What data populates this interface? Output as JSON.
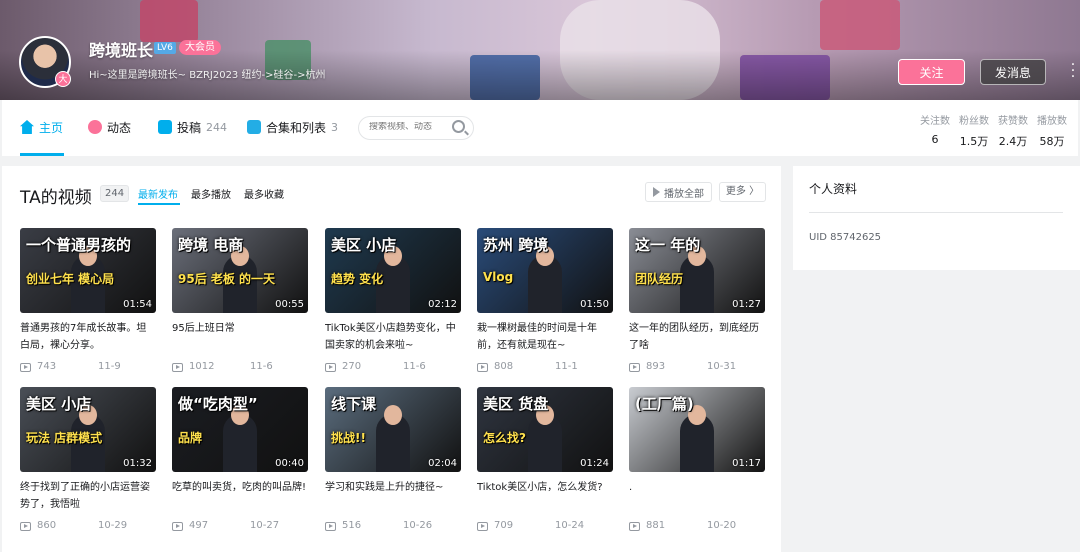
{
  "banner": {
    "username": "跨境班长",
    "level": "LV6",
    "vip_label": "大会员",
    "avatar_badge": "大",
    "signature": "Hi~这里是跨境班长~ BZRJ2023 纽约->硅谷->杭州",
    "follow_label": "关注",
    "message_label": "发消息",
    "more_label": "⋮"
  },
  "nav": {
    "tabs": [
      {
        "label": "主页",
        "count": "",
        "icon": "home-icon",
        "color": "#00aeec"
      },
      {
        "label": "动态",
        "count": "",
        "icon": "dynamic-icon",
        "color": "#fb7299"
      },
      {
        "label": "投稿",
        "count": "244",
        "icon": "upload-icon",
        "color": "#00aeec"
      },
      {
        "label": "合集和列表",
        "count": "3",
        "icon": "collection-icon",
        "color": "#00aeec"
      }
    ],
    "search_placeholder": "搜索视频、动态"
  },
  "stats": [
    {
      "label": "关注数",
      "value": "6"
    },
    {
      "label": "粉丝数",
      "value": "1.5万"
    },
    {
      "label": "获赞数",
      "value": "2.4万"
    },
    {
      "label": "播放数",
      "value": "58万"
    }
  ],
  "videos_section": {
    "title": "TA的视频",
    "count": "244",
    "sort_options": [
      "最新发布",
      "最多播放",
      "最多收藏"
    ],
    "play_all_label": "播放全部",
    "more_label": "更多 〉"
  },
  "videos": [
    {
      "cap1": "一个普通男孩的",
      "cap2": "创业七年 模心局",
      "duration": "01:54",
      "title": "普通男孩的7年成长故事。坦白局，裸心分享。",
      "plays": "743",
      "date": "11-9",
      "bg": "#3a3d45"
    },
    {
      "cap1": "跨境 电商",
      "cap2": "95后 老板 的一天",
      "duration": "00:55",
      "title": "95后上班日常",
      "plays": "1012",
      "date": "11-6",
      "bg": "#6b6f7a"
    },
    {
      "cap1": "美区 小店",
      "cap2": "趋势 变化",
      "duration": "02:12",
      "title": "TikTok美区小店趋势变化，中国卖家的机会来啦~",
      "plays": "270",
      "date": "11-6",
      "bg": "#1f3a4f"
    },
    {
      "cap1": "苏州 跨境",
      "cap2": "Vlog",
      "duration": "01:50",
      "title": "栽一棵树最佳的时间是十年前，还有就是现在~",
      "plays": "808",
      "date": "11-1",
      "bg": "#2a4c7a"
    },
    {
      "cap1": "这一 年的",
      "cap2": "团队经历",
      "duration": "01:27",
      "title": "这一年的团队经历，到底经历了啥",
      "plays": "893",
      "date": "10-31",
      "bg": "#8a8d95"
    },
    {
      "cap1": "美区 小店",
      "cap2": "玩法 店群模式",
      "duration": "01:32",
      "title": "终于找到了正确的小店运营姿势了，我悟啦",
      "plays": "860",
      "date": "10-29",
      "bg": "#4a4f57"
    },
    {
      "cap1": "做“吃肉型”",
      "cap2": "品牌",
      "duration": "00:40",
      "title": "吃草的叫卖货，吃肉的叫品牌!",
      "plays": "497",
      "date": "10-27",
      "bg": "#1b1d22"
    },
    {
      "cap1": "线下课",
      "cap2": "挑战!!",
      "duration": "02:04",
      "title": "学习和实践是上升的捷径~",
      "plays": "516",
      "date": "10-26",
      "bg": "#5b6d7e"
    },
    {
      "cap1": "美区 货盘",
      "cap2": "怎么找?",
      "duration": "01:24",
      "title": "Tiktok美区小店，怎么发货?",
      "plays": "709",
      "date": "10-24",
      "bg": "#2f3540"
    },
    {
      "cap1": "(工厂篇)",
      "cap2": "",
      "duration": "01:17",
      "title": ".",
      "plays": "881",
      "date": "10-20",
      "bg": "#c9ccd1"
    }
  ],
  "side": {
    "title": "个人资料",
    "uid": "UID  85742625"
  }
}
